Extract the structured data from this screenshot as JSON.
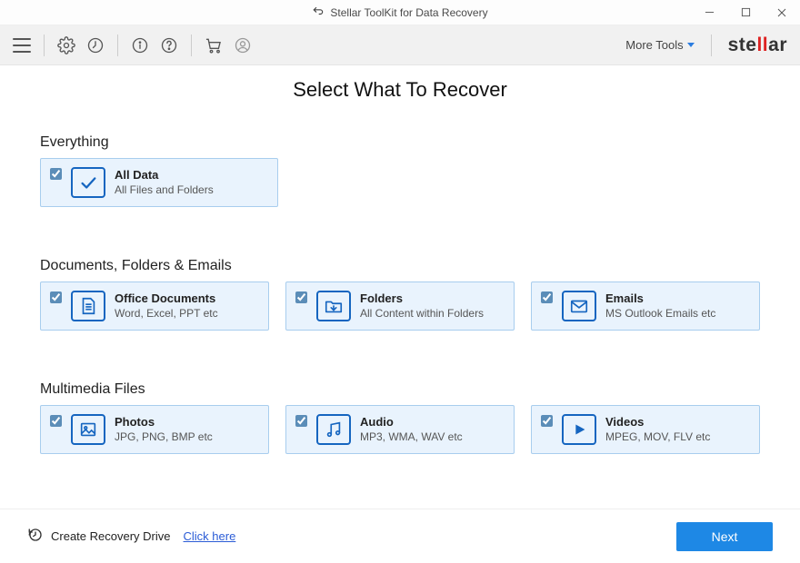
{
  "app": {
    "title": "Stellar ToolKit for Data Recovery"
  },
  "toolbar": {
    "more_tools": "More Tools",
    "brand_prefix": "ste",
    "brand_accent": "ll",
    "brand_suffix": "ar"
  },
  "main": {
    "heading": "Select What To Recover",
    "sections": {
      "everything": {
        "label": "Everything",
        "cards": [
          {
            "title": "All Data",
            "sub": "All Files and Folders",
            "checked": true
          }
        ]
      },
      "documents": {
        "label": "Documents, Folders & Emails",
        "cards": [
          {
            "title": "Office Documents",
            "sub": "Word, Excel, PPT etc",
            "checked": true
          },
          {
            "title": "Folders",
            "sub": "All Content within Folders",
            "checked": true
          },
          {
            "title": "Emails",
            "sub": "MS Outlook Emails etc",
            "checked": true
          }
        ]
      },
      "multimedia": {
        "label": "Multimedia Files",
        "cards": [
          {
            "title": "Photos",
            "sub": "JPG, PNG, BMP etc",
            "checked": true
          },
          {
            "title": "Audio",
            "sub": "MP3, WMA, WAV etc",
            "checked": true
          },
          {
            "title": "Videos",
            "sub": "MPEG, MOV, FLV etc",
            "checked": true
          }
        ]
      }
    }
  },
  "footer": {
    "drive_label": "Create Recovery Drive",
    "link_label": "Click here",
    "next": "Next"
  }
}
